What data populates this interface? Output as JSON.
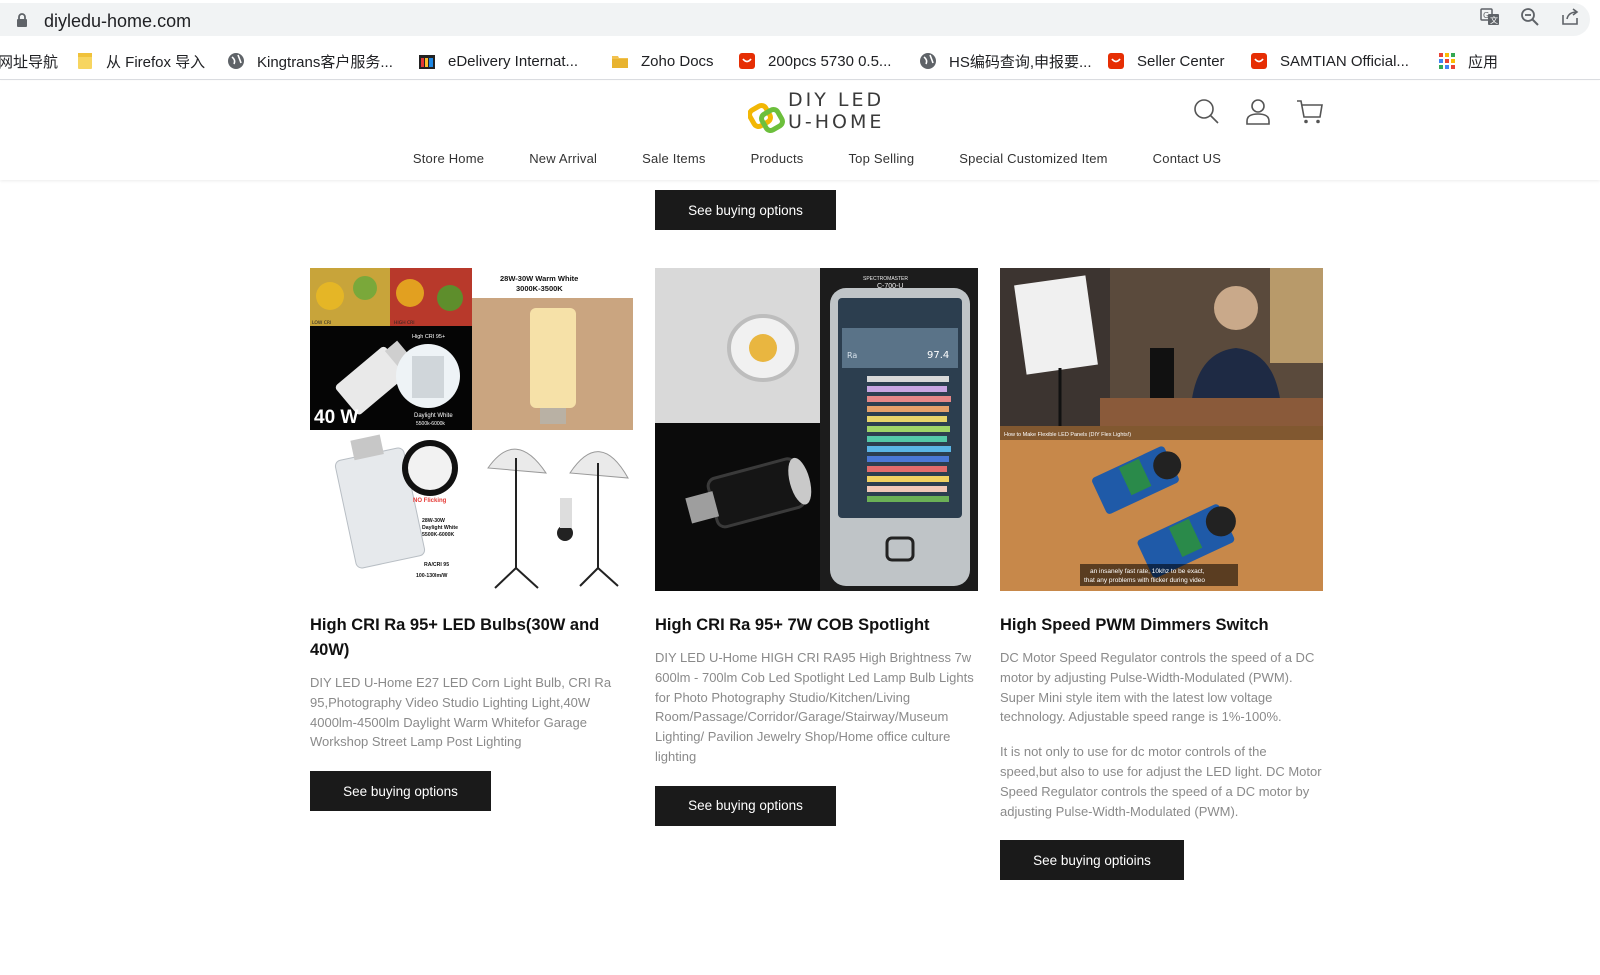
{
  "browser": {
    "url": "diyledu-home.com",
    "icons": [
      "translate-icon",
      "zoom-out-icon",
      "share-icon"
    ]
  },
  "bookmarks": [
    {
      "label": "网址导航",
      "icon": "none"
    },
    {
      "label": "从 Firefox 导入",
      "icon": "folder-icon"
    },
    {
      "label": "Kingtrans客户服务...",
      "icon": "globe-icon"
    },
    {
      "label": "eDelivery Internat...",
      "icon": "shop-icon"
    },
    {
      "label": "Zoho Docs",
      "icon": "folder-icon"
    },
    {
      "label": "200pcs 5730 0.5...",
      "icon": "store-icon"
    },
    {
      "label": "HS编码查询,申报要...",
      "icon": "globe-icon"
    },
    {
      "label": "Seller Center",
      "icon": "store-icon"
    },
    {
      "label": "SAMTIAN Official...",
      "icon": "store-icon"
    },
    {
      "label": "应用",
      "icon": "apps-grid-icon"
    }
  ],
  "site": {
    "logo": {
      "line1": "DIY LED",
      "line2": "U-HOME",
      "colors": {
        "yellow": "#f2b705",
        "green": "#6cbf3c"
      }
    },
    "header_icons": [
      "search-icon",
      "user-icon",
      "cart-icon"
    ],
    "nav": [
      "Store Home",
      "New Arrival",
      "Sale Items",
      "Products",
      "Top Selling",
      "Special Customized Item",
      "Contact US"
    ]
  },
  "top_button": "See buying options",
  "products": [
    {
      "title": "High CRI Ra 95+ LED Bulbs(30W and 40W)",
      "description": [
        "DIY LED U-Home E27 LED Corn Light Bulb, CRI Ra 95,Photography Video Studio Lighting Light,40W 4000lm-4500lm Daylight Warm Whitefor Garage Workshop Street Lamp Post Lighting"
      ],
      "button": "See buying options",
      "image_text": {
        "warm": "28W-30W Warm White\n3000K-3500K",
        "watt": "40 W",
        "daylight": "Daylight White\n5500k-6000k",
        "cri": "High CRI 95+",
        "noflick": "NO Flicking",
        "spec": "28W-30W\nDaylight White\n5500K-6000K",
        "ra": "RA/CRI 95\n100-130lm/W",
        "low": "LOW CRI",
        "high": "HIGH CRI"
      }
    },
    {
      "title": "High CRI Ra 95+ 7W COB Spotlight",
      "description": [
        "DIY LED U-Home HIGH CRI RA95 High Brightness 7w 600lm - 700lm Cob Led Spotlight Led Lamp Bulb Lights for Photo Photography Studio/Kitchen/Living Room/Passage/Corridor/Garage/Stairway/Museum Lighting/ Pavilion Jewelry Shop/Home office culture lighting"
      ],
      "button": "See buying options",
      "image_text": {
        "device": "SPECTROMASTER\nC-700-U",
        "ra_label": "Ra",
        "ra_value": "97.4"
      }
    },
    {
      "title": "High Speed PWM Dimmers Switch",
      "description": [
        "DC Motor Speed Regulator controls the speed of a DC motor by adjusting Pulse-Width-Modulated (PWM). Super Mini style item with the latest low voltage technology. Adjustable speed range is 1%-100%.",
        "It is not only to use for dc motor controls of the speed,but also to use for adjust the LED light. DC Motor Speed Regulator controls the speed of a DC motor by adjusting Pulse-Width-Modulated (PWM)."
      ],
      "button": "See buying optioins",
      "image_text": {
        "video_title": "How to Make Flexible LED Panels (DIY Flex Lights!)",
        "caption1": "an insanely fast rate, 10khz to be exact,",
        "caption2": "that any problems with flicker during video"
      }
    }
  ]
}
